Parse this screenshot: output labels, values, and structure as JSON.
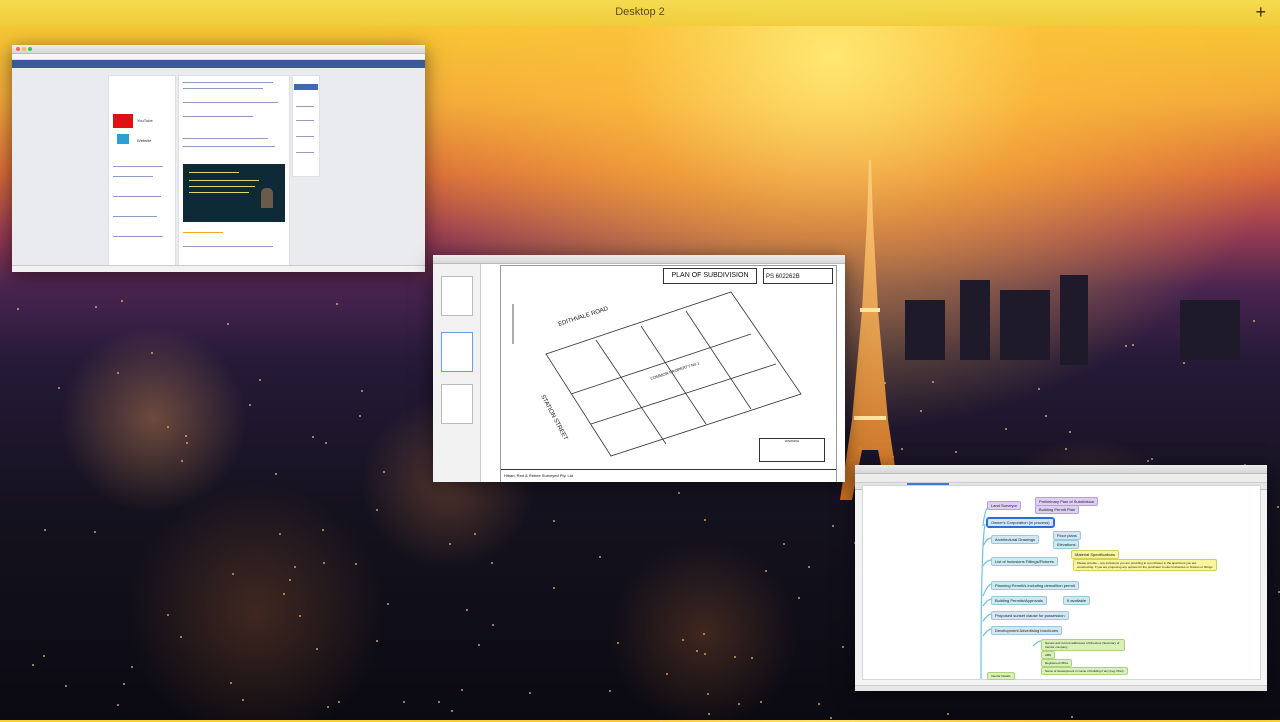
{
  "desktop": {
    "title": "Desktop 2",
    "add_label": "+"
  },
  "browser": {
    "sidebar_links": [
      "YouTube",
      "Website"
    ]
  },
  "pdf": {
    "plan_title": "PLAN OF SUBDIVISION",
    "plan_number": "PS 602262B",
    "road_labels": [
      "EDITHVALE ROAD",
      "STATION STREET"
    ],
    "common_label": "COMMON PROPERTY No.1",
    "footer_company": "Hiban, Red & Rebee Surveyed Pty. Ltd",
    "legend_title": "WARNING"
  },
  "mindmap": {
    "tabs": [
      "Marketing Agent Preparation",
      "Marketing OTP Preparation",
      "Marketing"
    ],
    "nodes": {
      "land_surveyor": "Land Surveyor",
      "prelim_plan": "Preliminary Plan of Subdivision",
      "building_permit_plan": "Building Permit Plan",
      "owners_corp": "Owner's Corporation (in process)",
      "architectural": "Architectural Drawings",
      "floor_plans": "Floor plans",
      "elevations": "Elevations",
      "inclusions": "List of Inclusions Fittings/Fixtures",
      "material_specs": "Material Specifications",
      "note": "Please provide – any inclusions you are providing to a purchaser in the apartment you are constructing. If you are proposing any options for the purchaser to elect inclusions or fixtures or fittings",
      "planning": "Planning Permit/s including demolition permit",
      "building_permits": "Building Permits/Approvals",
      "if_available": "If available",
      "sunset": "Proposed sunset clause for possession",
      "advertising": "Development Advertising brochures",
      "names_addresses": "Names and current addresses of Directors (Secretary of Vendor company",
      "abn": "ABN",
      "registered_office": "Registered Office",
      "name_dev": "Name of development or name of building if any (reg. Plan)",
      "vendor_details": "Vendor Details"
    }
  }
}
